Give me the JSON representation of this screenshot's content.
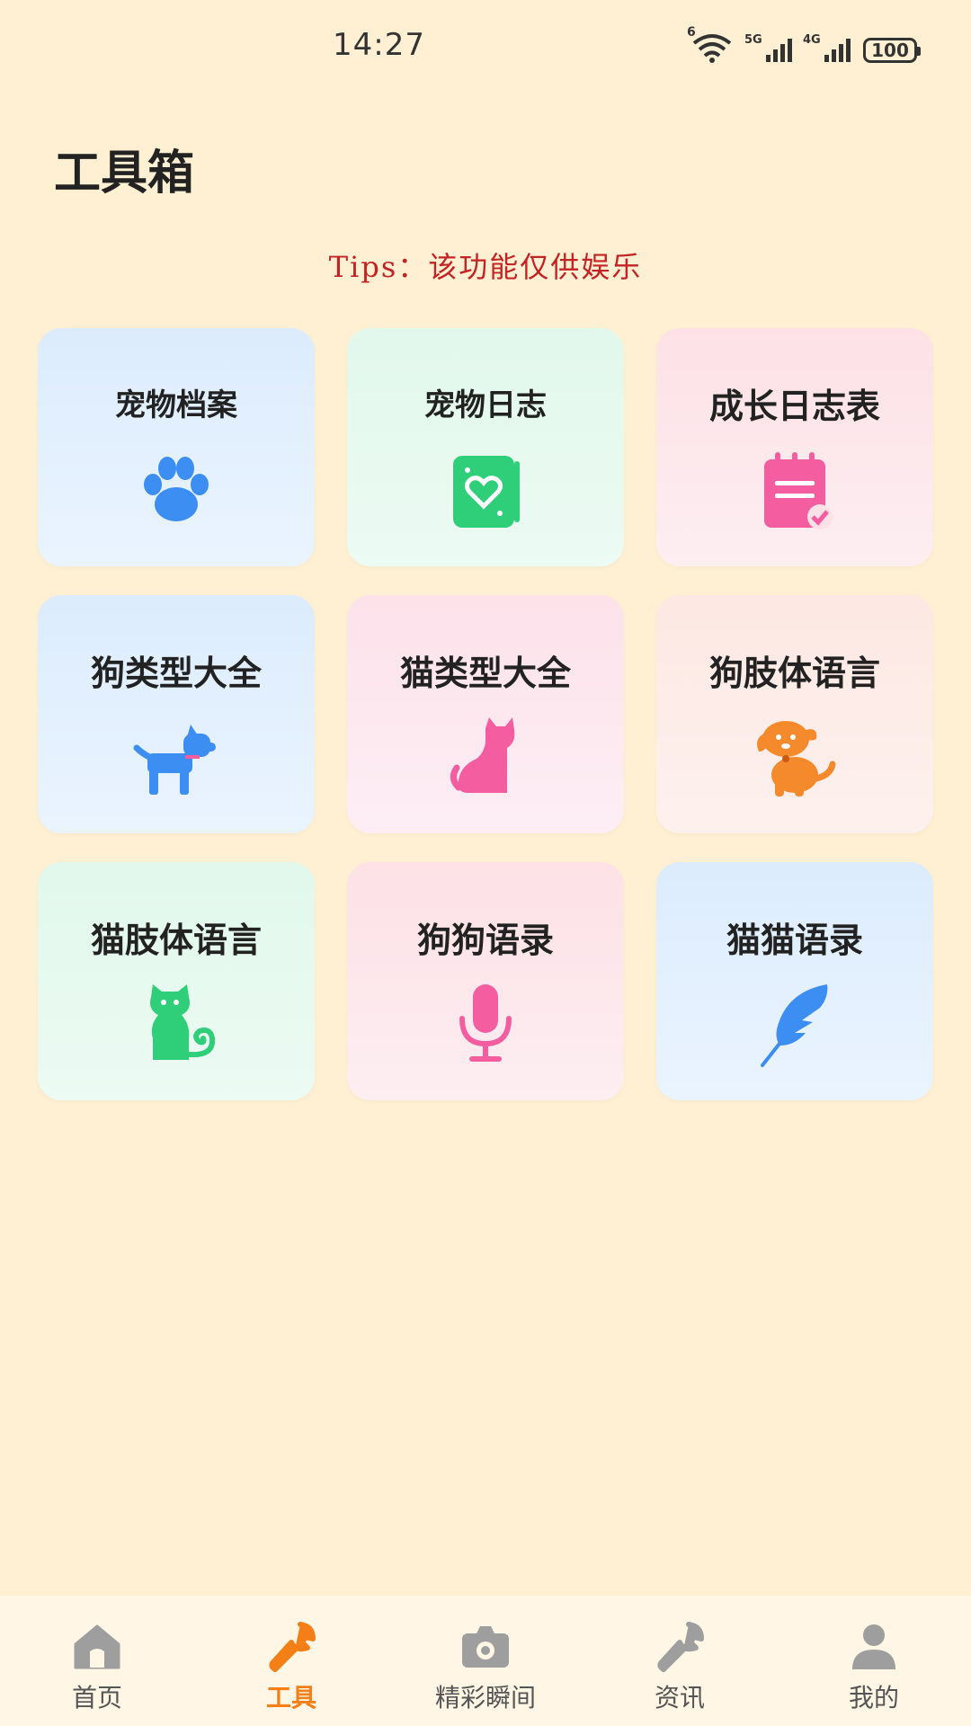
{
  "status_bar": {
    "time": "14:27",
    "wifi_label": "6",
    "signal_1_label": "5G",
    "signal_2_label": "4G",
    "battery": "100"
  },
  "page": {
    "title": "工具箱",
    "tips": "Tips：该功能仅供娱乐"
  },
  "tools": [
    {
      "label": "宠物档案",
      "icon": "paw-icon",
      "color": "#3d8ef2"
    },
    {
      "label": "宠物日志",
      "icon": "heart-notebook-icon",
      "color": "#2fcf7a"
    },
    {
      "label": "成长日志表",
      "icon": "calendar-check-icon",
      "color": "#f45da0"
    },
    {
      "label": "狗类型大全",
      "icon": "dog-icon",
      "color": "#3d8ef2"
    },
    {
      "label": "猫类型大全",
      "icon": "cat-icon",
      "color": "#f45da0"
    },
    {
      "label": "狗肢体语言",
      "icon": "puppy-icon",
      "color": "#f58a2c"
    },
    {
      "label": "猫肢体语言",
      "icon": "cat-sitting-icon",
      "color": "#2fcf7a"
    },
    {
      "label": "狗狗语录",
      "icon": "microphone-icon",
      "color": "#f45da0"
    },
    {
      "label": "猫猫语录",
      "icon": "feather-icon",
      "color": "#3d8ef2"
    }
  ],
  "bottom_nav": [
    {
      "label": "首页",
      "icon": "home-icon",
      "active": false
    },
    {
      "label": "工具",
      "icon": "wrench-icon",
      "active": true
    },
    {
      "label": "精彩瞬间",
      "icon": "camera-icon",
      "active": false
    },
    {
      "label": "资讯",
      "icon": "wrench-icon",
      "active": false
    },
    {
      "label": "我的",
      "icon": "user-icon",
      "active": false
    }
  ],
  "colors": {
    "background": "#fff0d3",
    "accent": "#f57f17",
    "tips": "#c42323"
  }
}
